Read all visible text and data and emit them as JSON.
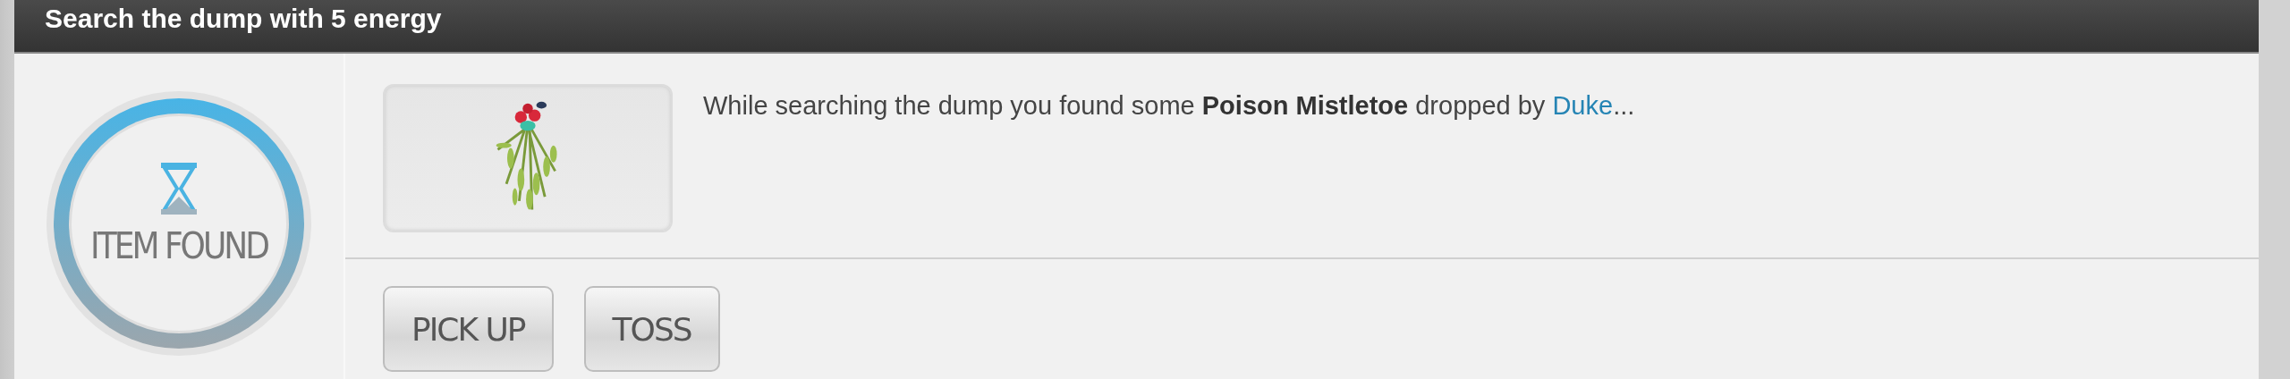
{
  "header": {
    "title": "Search the dump with 5 energy"
  },
  "status": {
    "label": "ITEM FOUND"
  },
  "message": {
    "text": "While searching the dump you found some **Poison Mistletoe** dropped by",
    "link": "Duke",
    "suffix": "..."
  },
  "buttons": [
    "PICK UP",
    "TOSS"
  ]
}
